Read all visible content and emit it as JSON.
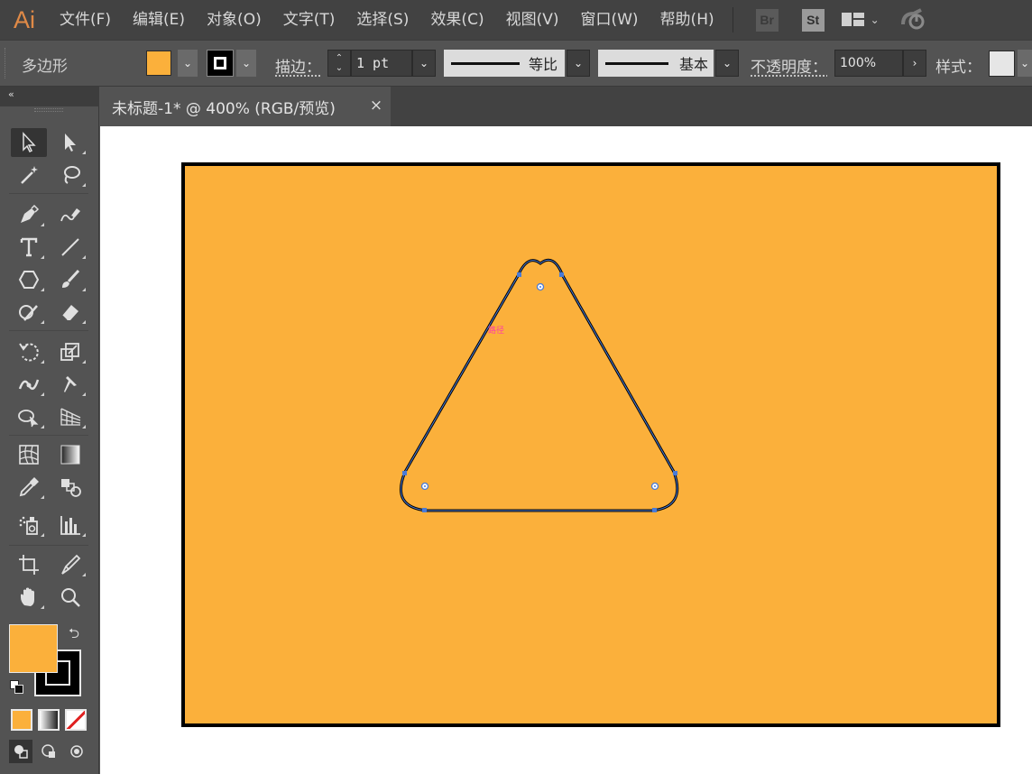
{
  "app": {
    "logo": "Ai"
  },
  "menu": [
    {
      "label": "文件(F)"
    },
    {
      "label": "编辑(E)"
    },
    {
      "label": "对象(O)"
    },
    {
      "label": "文字(T)"
    },
    {
      "label": "选择(S)"
    },
    {
      "label": "效果(C)"
    },
    {
      "label": "视图(V)"
    },
    {
      "label": "窗口(W)"
    },
    {
      "label": "帮助(H)"
    }
  ],
  "menu_right": {
    "bridge": "Br",
    "stock": "St",
    "workspace_icon": "workspace-layout-icon",
    "sync_icon": "sync-icon"
  },
  "control_bar": {
    "selection_type": "多边形",
    "stroke_label": "描边：",
    "stroke_weight": "1 pt",
    "variable_width": "等比",
    "brush": "基本",
    "opacity_label": "不透明度：",
    "opacity_value": "100%",
    "style_label": "样式："
  },
  "document": {
    "tab_title": "未标题-1* @ 400% (RGB/预览)",
    "close": "×"
  },
  "colors": {
    "fill": "#FBB03B",
    "stroke": "#000000",
    "selection": "#4a7bd6",
    "smart_guide": "#ff3fa6"
  },
  "canvas": {
    "smart_guide_label": "路径"
  },
  "tools": [
    "selection-tool",
    "direct-selection-tool",
    "magic-wand-tool",
    "lasso-tool",
    "pen-tool",
    "curvature-tool",
    "type-tool",
    "line-tool",
    "polygon-tool",
    "paintbrush-tool",
    "shaper-tool",
    "eraser-tool",
    "rotate-tool",
    "scale-tool",
    "width-tool",
    "puppet-warp-tool",
    "shape-builder-tool",
    "perspective-grid-tool",
    "mesh-tool",
    "gradient-tool",
    "eyedropper-tool",
    "blend-tool",
    "symbol-sprayer-tool",
    "column-graph-tool",
    "artboard-tool",
    "slice-tool",
    "hand-tool",
    "zoom-tool"
  ]
}
